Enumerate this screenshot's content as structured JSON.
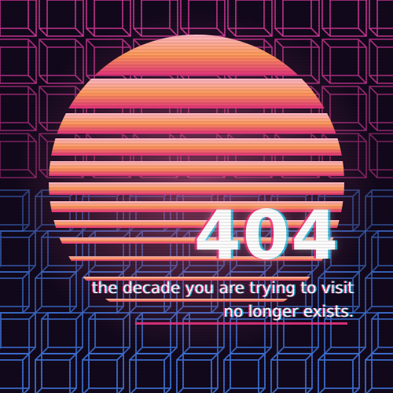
{
  "error": {
    "code": "404",
    "message_line_1": "the decade you are trying to visit",
    "message_line_2": "no longer exists."
  },
  "theme": {
    "background": "#12081c",
    "grid_top": "#d93a9c",
    "grid_bottom": "#3f74d8",
    "sun_top": "#ffb8c8",
    "sun_middle": "#ff9a5a",
    "sun_bottom": "#e0307a",
    "accent_line": "#ff3a8a",
    "text": "#ffffff"
  }
}
